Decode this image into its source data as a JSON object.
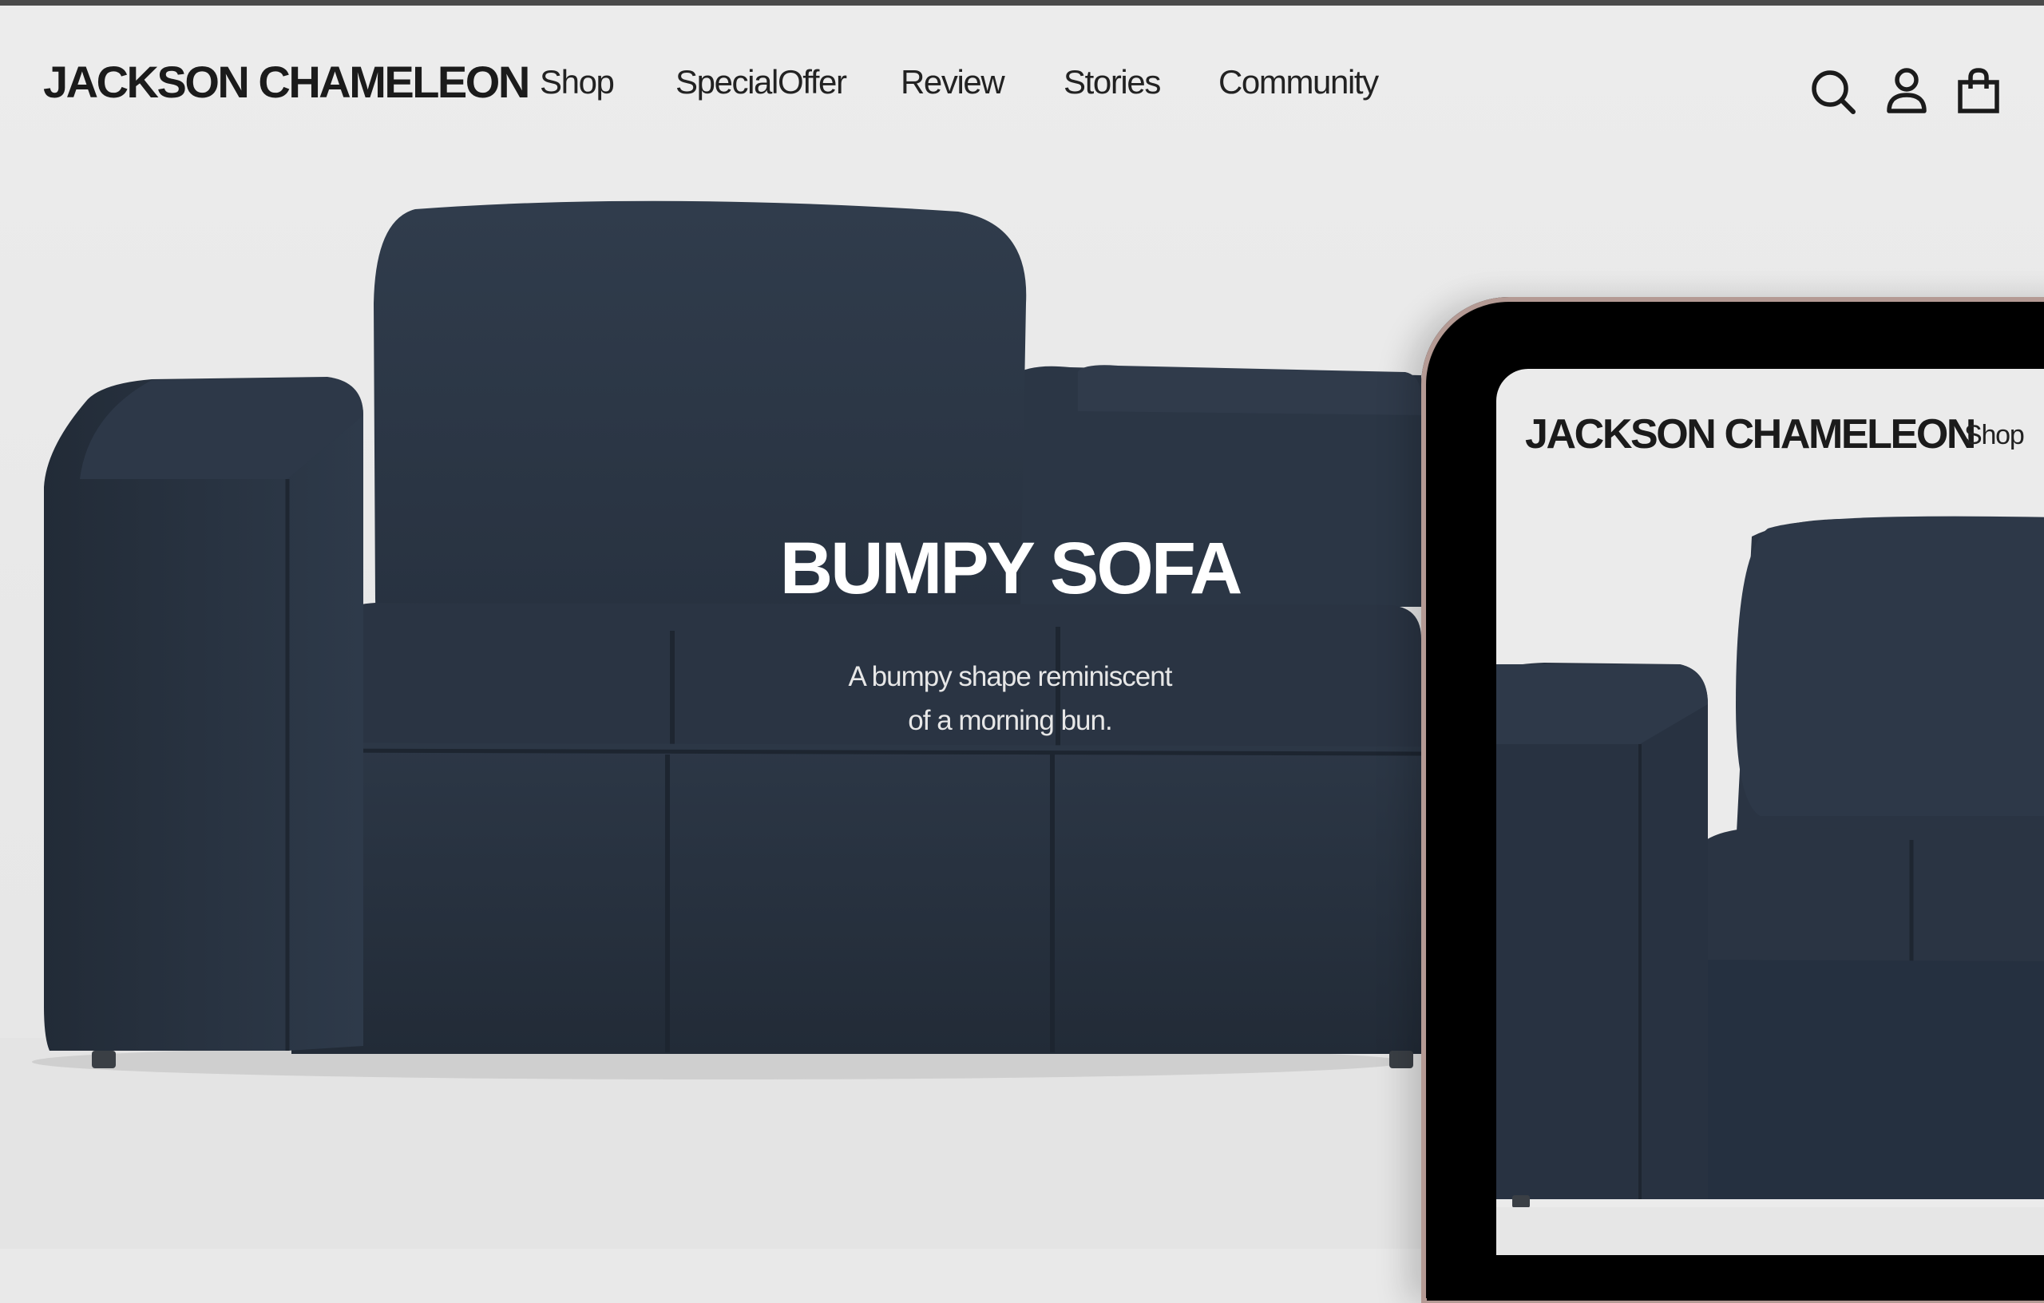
{
  "header": {
    "brand": "JACKSON CHAMELEON",
    "nav": [
      {
        "label": "Shop"
      },
      {
        "label": "SpecialOffer"
      },
      {
        "label": "Review"
      },
      {
        "label": "Stories"
      },
      {
        "label": "Community"
      }
    ],
    "icons": [
      "search-icon",
      "user-icon",
      "bag-icon"
    ]
  },
  "hero": {
    "title": "BUMPY SOFA",
    "subtitle_line1": "A bumpy shape reminiscent",
    "subtitle_line2": "of a morning bun."
  },
  "tablet": {
    "brand": "JACKSON CHAMELEON",
    "nav_first": "Shop"
  },
  "colors": {
    "background": "#e9e9e9",
    "sofa": "#263140",
    "text_dark": "#1b1b1b",
    "hero_text": "#ffffff"
  }
}
